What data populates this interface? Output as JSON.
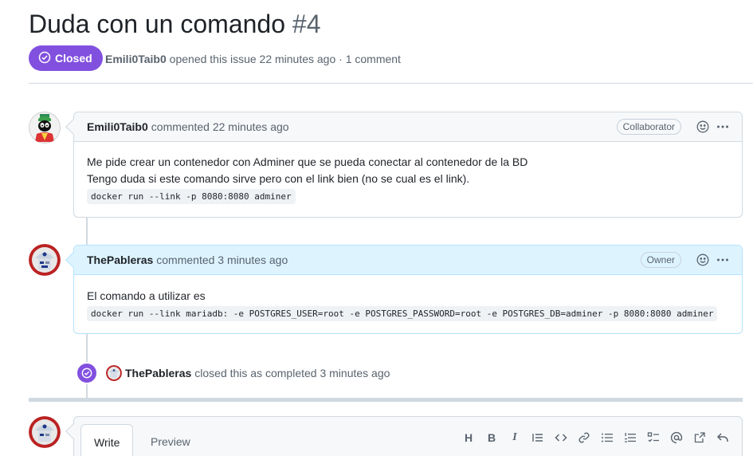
{
  "issue": {
    "title": "Duda con un comando",
    "number": "#4",
    "state": "Closed",
    "author": "Emili0Taib0",
    "opened_text": "opened this issue 22 minutes ago · 1 comment"
  },
  "comments": [
    {
      "author": "Emili0Taib0",
      "action": "commented 22 minutes ago",
      "role": "Collaborator",
      "body_lines": [
        "Me pide crear un contenedor con Adminer que se pueda conectar al contenedor de la BD",
        "Tengo duda si este comando sirve pero con el link bien (no se cual es el link)."
      ],
      "code": "docker run --link -p 8080:8080 adminer"
    },
    {
      "author": "ThePableras",
      "action": "commented 3 minutes ago",
      "role": "Owner",
      "body_lines": [
        "El comando a utilizar es"
      ],
      "code": "docker run --link mariadb: -e POSTGRES_USER=root -e POSTGRES_PASSWORD=root -e POSTGRES_DB=adminer -p 8080:8080 adminer"
    }
  ],
  "event": {
    "actor": "ThePableras",
    "text": "closed this as completed 3 minutes ago"
  },
  "editor": {
    "tabs": [
      "Write",
      "Preview"
    ],
    "toolbar_icons": [
      "heading-icon",
      "bold-icon",
      "italic-icon",
      "quote-icon",
      "code-icon",
      "link-icon",
      "unordered-list-icon",
      "ordered-list-icon",
      "task-list-icon",
      "mention-icon",
      "reference-icon",
      "reply-icon"
    ],
    "heading_label": "H",
    "bold_label": "B",
    "italic_label": "I"
  },
  "colors": {
    "closed_purple": "#8250df",
    "owner_header_bg": "#ddf4ff",
    "border": "#d1d9e0"
  }
}
